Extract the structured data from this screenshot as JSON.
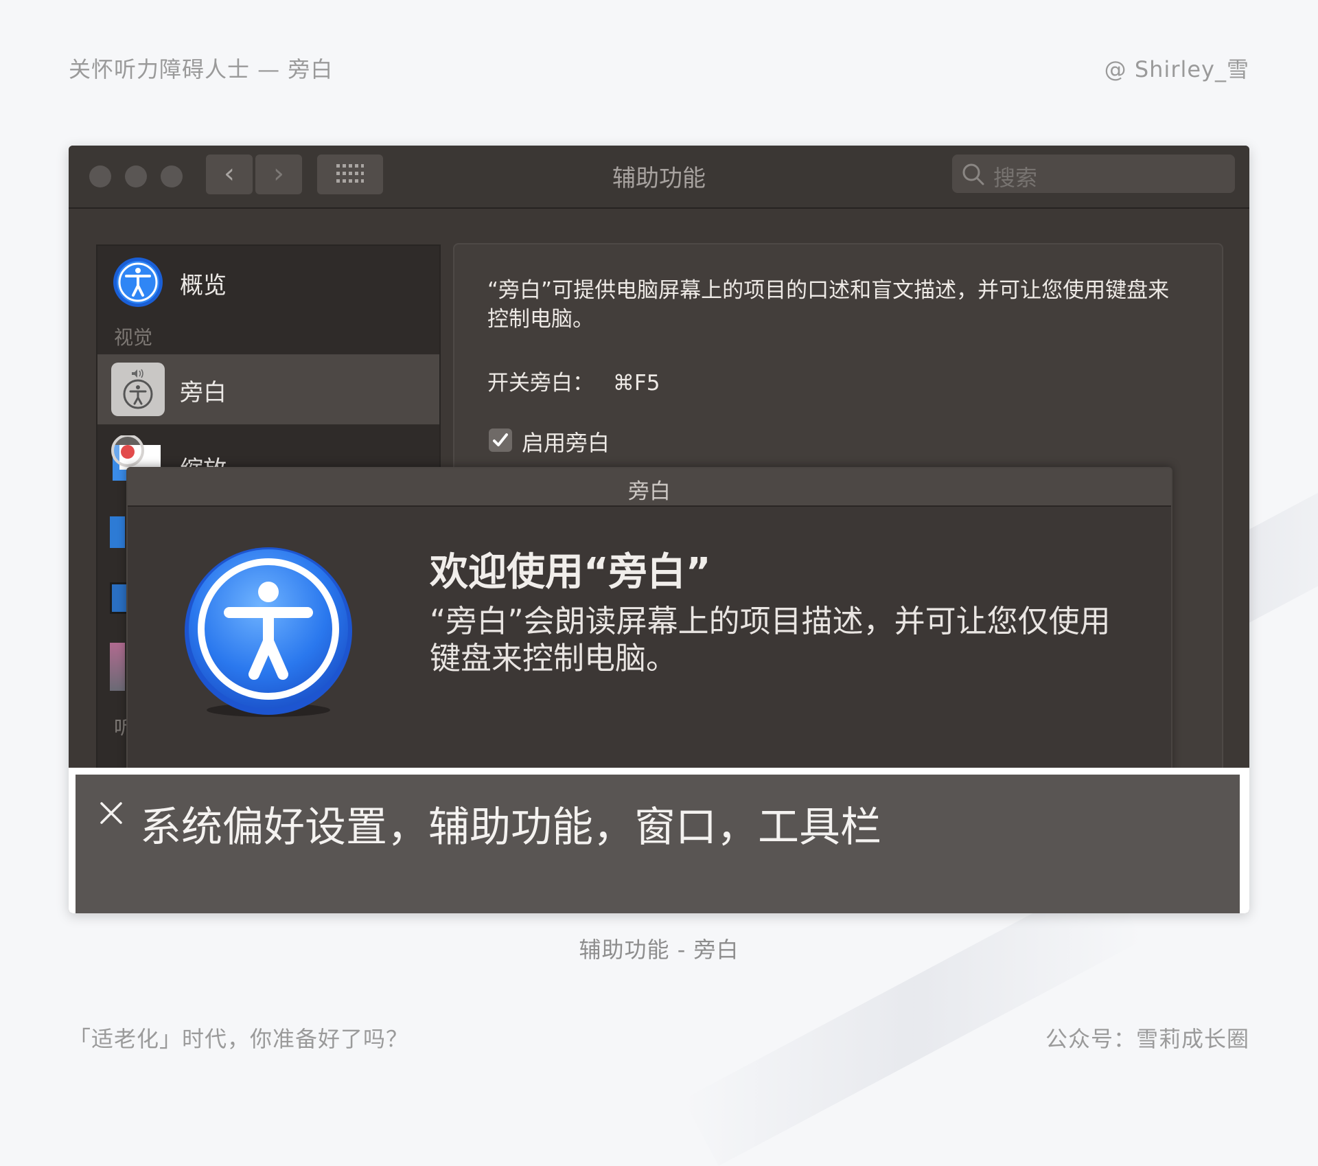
{
  "page": {
    "header_left": "关怀听力障碍人士 — 旁白",
    "header_right": "@ Shirley_雪",
    "caption": "辅助功能 - 旁白",
    "footer_left": "「适老化」时代，你准备好了吗？",
    "footer_right": "公众号：雪莉成长圈"
  },
  "window": {
    "title": "辅助功能",
    "search_placeholder": "搜索",
    "nav_back": "‹",
    "nav_forward": "›"
  },
  "sidebar": {
    "overview_label": "概览",
    "section_vision": "视觉",
    "item_voiceover": "旁白",
    "item_zoom": "缩放",
    "section_hearing_partial": "听"
  },
  "content": {
    "description": "“旁白”可提供电脑屏幕上的项目的口述和盲文描述，并可让您使用键盘来控制电脑。",
    "shortcut_label": "开关旁白：",
    "shortcut_key": "⌘F5",
    "enable_checkbox_label": "启用旁白",
    "enable_checked": true
  },
  "dialog": {
    "title": "旁白",
    "heading": "欢迎使用“旁白”",
    "body": "“旁白”会朗读屏幕上的项目描述，并可让您仅使用键盘来控制电脑。"
  },
  "caption_panel": {
    "text": "系统偏好设置，辅助功能，窗口，工具栏"
  },
  "colors": {
    "accent_blue": "#2f7cf0",
    "window_bg": "#3d3835"
  }
}
